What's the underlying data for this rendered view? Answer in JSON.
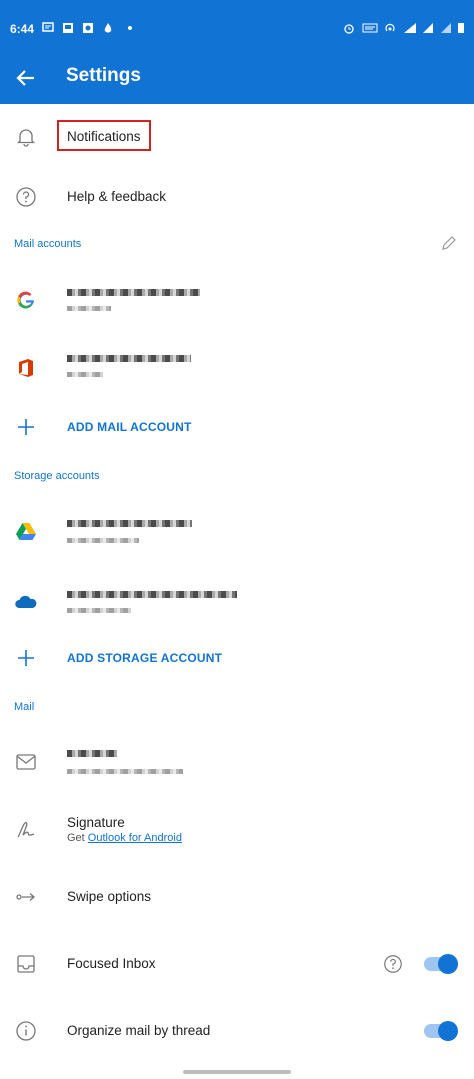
{
  "status_bar": {
    "time": "6:44"
  },
  "app_bar": {
    "title": "Settings"
  },
  "top_items": [
    {
      "label": "Notifications",
      "icon": "bell-icon"
    },
    {
      "label": "Help & feedback",
      "icon": "help-icon"
    }
  ],
  "mail_accounts": {
    "header": "Mail accounts",
    "add_label": "ADD MAIL ACCOUNT"
  },
  "storage_accounts": {
    "header": "Storage accounts",
    "add_label": "ADD STORAGE ACCOUNT"
  },
  "mail_section": {
    "header": "Mail",
    "signature": {
      "label": "Signature",
      "sub_prefix": "Get ",
      "sub_link": "Outlook for Android"
    },
    "swipe": {
      "label": "Swipe options"
    },
    "focused": {
      "label": "Focused Inbox"
    },
    "thread": {
      "label": "Organize mail by thread"
    }
  },
  "colors": {
    "accent": "#1173d4",
    "highlight": "#d32222"
  }
}
